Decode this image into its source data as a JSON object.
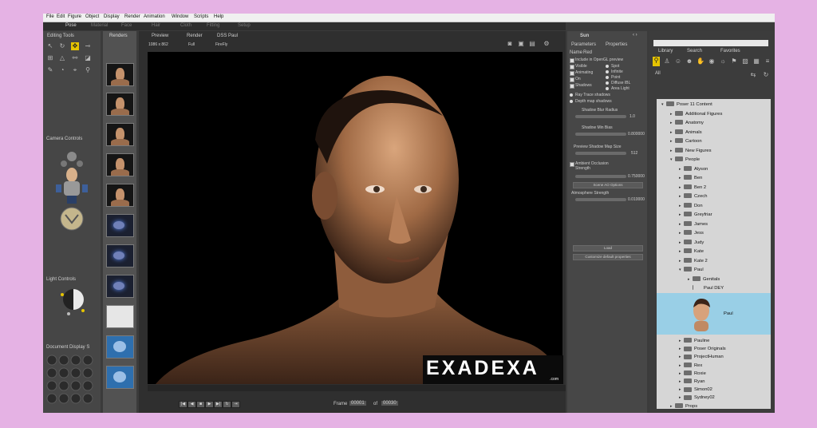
{
  "menu": [
    "File",
    "Edit",
    "Figure",
    "Object",
    "Display",
    "Render",
    "Animation",
    "Window",
    "Scripts",
    "Help"
  ],
  "room_tabs": [
    "Pose",
    "Material",
    "Face",
    "Hair",
    "Cloth",
    "Fitting",
    "Setup"
  ],
  "view_tabs": [
    "Preview",
    "Render",
    "DSS Paul"
  ],
  "render_info": {
    "size": "1086 x 862",
    "mode": "Full",
    "effect": "FireFly"
  },
  "left_panel": {
    "editing_tools": "Editing Tools",
    "camera_controls": "Camera Controls",
    "light_controls": "Light Controls",
    "document_display": "Document Display S"
  },
  "strip_title": "Renders",
  "props": {
    "title": "Sun",
    "tabs": [
      "Parameters",
      "Properties"
    ],
    "subtabs": [
      "Name",
      "Red"
    ],
    "checks": [
      "Include in OpenGL preview",
      "Visible",
      "Animating",
      "On",
      "Shadows"
    ],
    "radios": [
      "Spot",
      "Infinite",
      "Point",
      "Diffuse IBL",
      "Area Light"
    ],
    "shadow_modes": [
      "Ray Trace shadows",
      "Depth map shadows"
    ],
    "shadow_blur_label": "Shadow Blur Radius",
    "shadow_blur_value": "1.0",
    "shadow_min_label": "Shadow Min Bias",
    "shadow_min_value": "0.800000",
    "map_size_label": "Preview Shadow Map Size",
    "map_size_value": "512",
    "ao_label": "Ambient Occlusion Strength",
    "ao_value": "0.750000",
    "ao_button": "Scene AO Options",
    "atmos_label": "Atmosphere Strength",
    "atmos_value": "0.010000",
    "load_button": "Load",
    "save_button": "Customize default properties"
  },
  "library": {
    "tabs": [
      "Library",
      "Search",
      "Favorites"
    ],
    "filter": "All",
    "tree": [
      {
        "label": "Poser 11 Content",
        "indent": 0,
        "twisty": "down"
      },
      {
        "label": "Additional Figures",
        "indent": 1,
        "twisty": "right"
      },
      {
        "label": "Anatomy",
        "indent": 1,
        "twisty": "right"
      },
      {
        "label": "Animals",
        "indent": 1,
        "twisty": "right"
      },
      {
        "label": "Cartoon",
        "indent": 1,
        "twisty": "right"
      },
      {
        "label": "New Figures",
        "indent": 1,
        "twisty": "right"
      },
      {
        "label": "People",
        "indent": 1,
        "twisty": "down"
      },
      {
        "label": "Alyson",
        "indent": 2,
        "twisty": "right"
      },
      {
        "label": "Ben",
        "indent": 2,
        "twisty": "right"
      },
      {
        "label": "Ben 2",
        "indent": 2,
        "twisty": "right"
      },
      {
        "label": "Czech",
        "indent": 2,
        "twisty": "right"
      },
      {
        "label": "Don",
        "indent": 2,
        "twisty": "right"
      },
      {
        "label": "Greyfriar",
        "indent": 2,
        "twisty": "right"
      },
      {
        "label": "James",
        "indent": 2,
        "twisty": "right"
      },
      {
        "label": "Jess",
        "indent": 2,
        "twisty": "right"
      },
      {
        "label": "Judy",
        "indent": 2,
        "twisty": "right"
      },
      {
        "label": "Kate",
        "indent": 2,
        "twisty": "right"
      },
      {
        "label": "Kate 2",
        "indent": 2,
        "twisty": "right"
      },
      {
        "label": "Paul",
        "indent": 2,
        "twisty": "down"
      },
      {
        "label": "Genitals",
        "indent": 3,
        "twisty": "right"
      },
      {
        "label": "Paul DEY",
        "indent": 3,
        "twisty": ""
      }
    ],
    "selected_item": "Paul",
    "tree_after": [
      {
        "label": "Pauline",
        "indent": 2
      },
      {
        "label": "Poser Originals",
        "indent": 2
      },
      {
        "label": "ProjectHuman",
        "indent": 2
      },
      {
        "label": "Rex",
        "indent": 2
      },
      {
        "label": "Roxie",
        "indent": 2
      },
      {
        "label": "Ryan",
        "indent": 2
      },
      {
        "label": "Simon02",
        "indent": 2
      },
      {
        "label": "Sydney02",
        "indent": 2
      },
      {
        "label": "Props",
        "indent": 1
      }
    ]
  },
  "bottom": {
    "frame_label": "Frame",
    "frame_value": "00001",
    "of_label": "of",
    "total": "00030"
  },
  "watermark": {
    "text": "EXADEXA",
    "domain": ".com"
  },
  "colors": {
    "background": "#e5b2e4",
    "selection": "#99cfe6",
    "active_tool": "#e6c400"
  }
}
